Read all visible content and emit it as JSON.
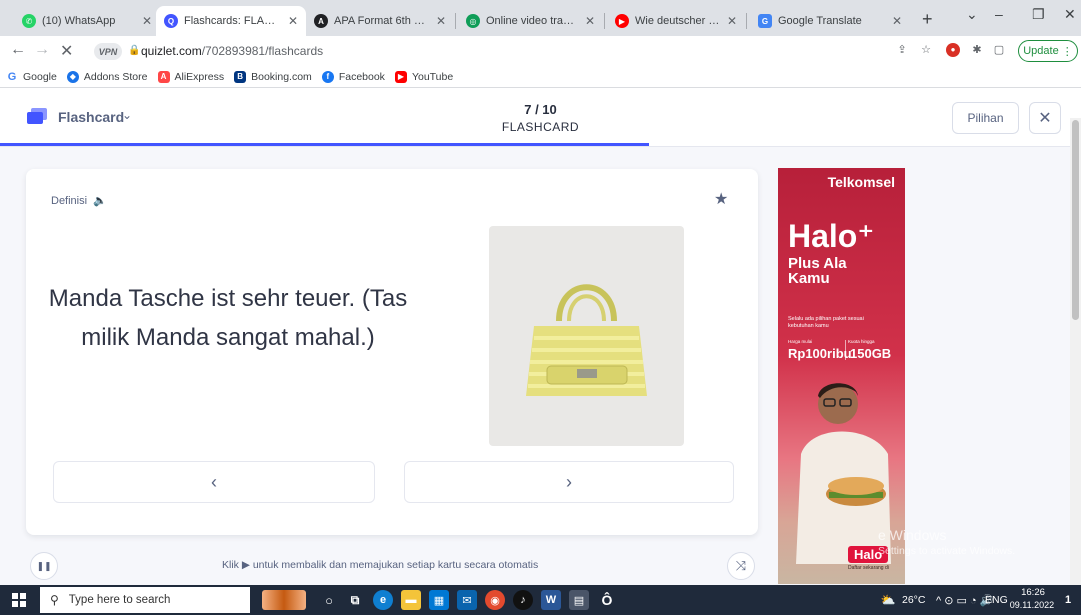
{
  "browser": {
    "tabs": [
      {
        "label": "(10) WhatsApp",
        "icon": "whatsapp-icon",
        "color": "#25d366"
      },
      {
        "label": "Flashcards: FLASHCAR",
        "icon": "quizlet-icon",
        "color": "#4255ff",
        "active": true
      },
      {
        "label": "APA Format 6th Editio",
        "icon": "apa-icon",
        "color": "#202124"
      },
      {
        "label": "Online video transcrip",
        "icon": "transcribe-icon",
        "color": "#0f9d58"
      },
      {
        "label": "Wie deutscher Plastik",
        "icon": "youtube-icon",
        "color": "#ff0000"
      },
      {
        "label": "Google Translate",
        "icon": "translate-icon",
        "color": "#4285f4"
      }
    ],
    "url_host": "quizlet.com",
    "url_path": "/702893981/flashcards",
    "vpn_label": "VPN",
    "update_label": "Update",
    "bookmarks": [
      {
        "label": "Google",
        "icon": "google-icon",
        "color": "#4285f4"
      },
      {
        "label": "Addons Store",
        "icon": "addons-icon",
        "color": "#1a73e8"
      },
      {
        "label": "AliExpress",
        "icon": "aliexpress-icon",
        "color": "#ff4747"
      },
      {
        "label": "Booking.com",
        "icon": "booking-icon",
        "color": "#003580"
      },
      {
        "label": "Facebook",
        "icon": "facebook-icon",
        "color": "#1877f2"
      },
      {
        "label": "YouTube",
        "icon": "youtube-icon",
        "color": "#ff0000"
      }
    ]
  },
  "quizlet": {
    "mode_label": "Flashcard",
    "progress_count": "7 / 10",
    "progress_mode": "FLASHCARD",
    "progress_fraction": 0.6,
    "options_label": "Pilihan",
    "accent_color": "#4255ff",
    "card": {
      "side_label": "Definisi",
      "text": "Manda Tasche ist sehr teuer. (Tas milik Manda sangat mahal.)",
      "image_subject": "yellow handbag"
    },
    "auto_hint": "Klik ▶ untuk membalik dan memajukan setiap kartu secara otomatis"
  },
  "ad": {
    "brand": "Telkomsel",
    "headline": "Halo⁺",
    "tagline": "Plus Ala Kamu",
    "small_text": "Selalu ada pilihan paket sesuai kebutuhan kamu",
    "price_label_a": "Harga mulai",
    "price_a": "Rp100ribu",
    "price_label_b": "Kuota hingga",
    "price_b": "150GB",
    "footer_logo": "Halo",
    "footer_text": "Daftar sekarang di",
    "primary_color": "#c8243f"
  },
  "watermark": {
    "line1": "e Windows",
    "line2": "Settings to activate Windows."
  },
  "taskbar": {
    "search_placeholder": "Type here to search",
    "weather": "26°C",
    "language": "ENG",
    "time": "16:26",
    "date": "09.11.2022",
    "notification_count": "1"
  }
}
